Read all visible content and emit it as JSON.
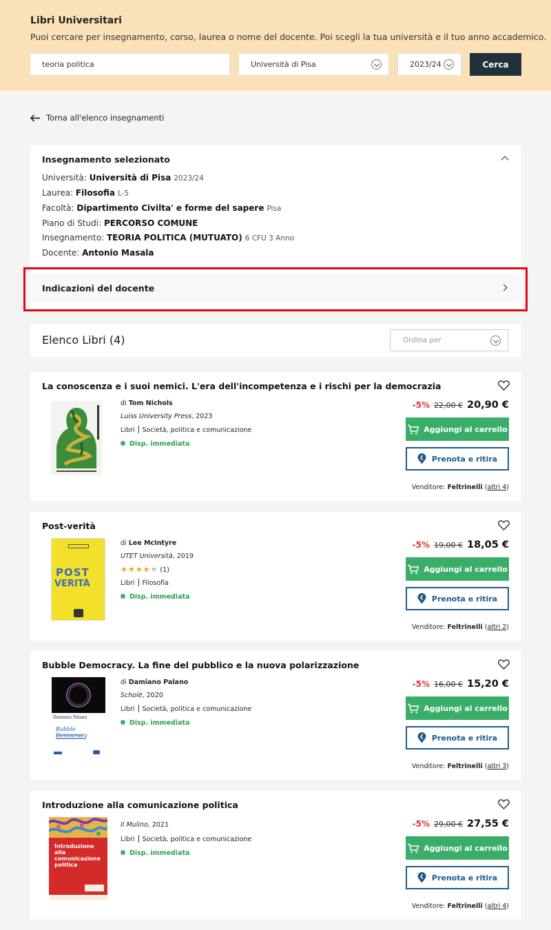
{
  "header": {
    "title": "Libri Universitari",
    "subtitle": "Puoi cercare per insegnamento, corso, laurea o nome del docente. Poi scegli la tua università e il tuo anno accademico.",
    "search_value": "teoria politica",
    "university": "Università di Pisa",
    "year": "2023/24",
    "search_button": "Cerca"
  },
  "back_link": "Torna all'elenco insegnamenti",
  "selected": {
    "title": "Insegnamento selezionato",
    "rows": [
      {
        "label": "Università:",
        "value": "Università di Pisa",
        "extra": "2023/24"
      },
      {
        "label": "Laurea:",
        "value": "Filosofia",
        "extra": "L-5"
      },
      {
        "label": "Facoltà:",
        "value": "Dipartimento Civilta' e forme del sapere",
        "extra": "Pisa"
      },
      {
        "label": "Piano di Studi:",
        "value": "PERCORSO COMUNE",
        "extra": ""
      },
      {
        "label": "Insegnamento:",
        "value": "TEORIA POLITICA (MUTUATO)",
        "extra": "6 CFU  3 Anno"
      },
      {
        "label": "Docente:",
        "value": "Antonio Masala",
        "extra": ""
      }
    ],
    "indications": "Indicazioni del docente"
  },
  "list": {
    "title": "Elenco Libri (4)",
    "sort_placeholder": "Ordina per"
  },
  "books": [
    {
      "title": "La conoscenza e i suoi nemici. L'era dell'incompetenza e i rischi per la democrazia",
      "author_prefix": "di",
      "author": "Tom Nichols",
      "publisher": "Luiss University Press",
      "year": ", 2023",
      "type": "Libri",
      "category": "Società, politica e comunicazione",
      "availability": "Disp. immediata",
      "discount": "-5%",
      "old_price": "22,00 €",
      "price": "20,90 €",
      "cart": "Aggiungi al carrello",
      "reserve": "Prenota e ritira",
      "vendor_label": "Venditore:",
      "vendor": "Feltrinelli",
      "others": "altri 4"
    },
    {
      "title": "Post-verità",
      "author_prefix": "di",
      "author": "Lee McIntyre",
      "publisher": "UTET Università",
      "year": ", 2019",
      "rating": 4,
      "rating_count": "(1)",
      "type": "Libri",
      "category": "Filosofia",
      "availability": "Disp. immediata",
      "discount": "-5%",
      "old_price": "19,00 €",
      "price": "18,05 €",
      "cart": "Aggiungi al carrello",
      "reserve": "Prenota e ritira",
      "vendor_label": "Venditore:",
      "vendor": "Feltrinelli",
      "others": "altri 2",
      "cover_text_1": "POST",
      "cover_text_2": "VERITÀ"
    },
    {
      "title": "Bubble Democracy. La fine del pubblico e la nuova polarizzazione",
      "author_prefix": "di",
      "author": "Damiano Palano",
      "publisher": "Scholé",
      "year": ", 2020",
      "type": "Libri",
      "category": "Società, politica e comunicazione",
      "availability": "Disp. immediata",
      "discount": "-5%",
      "old_price": "16,00 €",
      "price": "15,20 €",
      "cart": "Aggiungi al carrello",
      "reserve": "Prenota e ritira",
      "vendor_label": "Venditore:",
      "vendor": "Feltrinelli",
      "others": "altri 3",
      "cover_author": "Damiano Palano",
      "cover_title": "Bubble Democracy"
    },
    {
      "title": "Introduzione alla comunicazione politica",
      "publisher": "Il Mulino",
      "year": ", 2021",
      "type": "Libri",
      "category": "Società, politica e comunicazione",
      "availability": "Disp. immediata",
      "discount": "-5%",
      "old_price": "29,00 €",
      "price": "27,55 €",
      "cart": "Aggiungi al carrello",
      "reserve": "Prenota e ritira",
      "vendor_label": "Venditore:",
      "vendor": "Feltrinelli",
      "others": "altri 4",
      "cover_title": "Introduzione alla comunicazione politica"
    }
  ]
}
